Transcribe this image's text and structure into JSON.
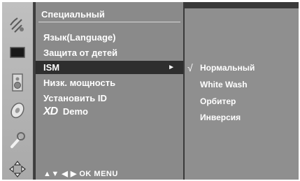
{
  "menu": {
    "title": "Специальный",
    "items": [
      {
        "label": "Язык(Language)"
      },
      {
        "label": "Защита от детей"
      },
      {
        "label": "ISM",
        "arrow": "►"
      },
      {
        "label": "Низк. мощность"
      },
      {
        "label": "Установить ID"
      },
      {
        "label": "Demo",
        "badge": "XD"
      }
    ]
  },
  "hint": "▲▼  ◀ ▶  OK  MENU",
  "submenu": {
    "items": [
      {
        "label": "Нормальный",
        "check": "√"
      },
      {
        "label": "White Wash"
      },
      {
        "label": "Орбитер"
      },
      {
        "label": "Инверсия"
      }
    ]
  },
  "sidebar_icons": [
    "satellite-icon",
    "screen-icon",
    "speaker-icon",
    "disc-icon",
    "wrench-icon",
    "move-arrows-icon"
  ]
}
